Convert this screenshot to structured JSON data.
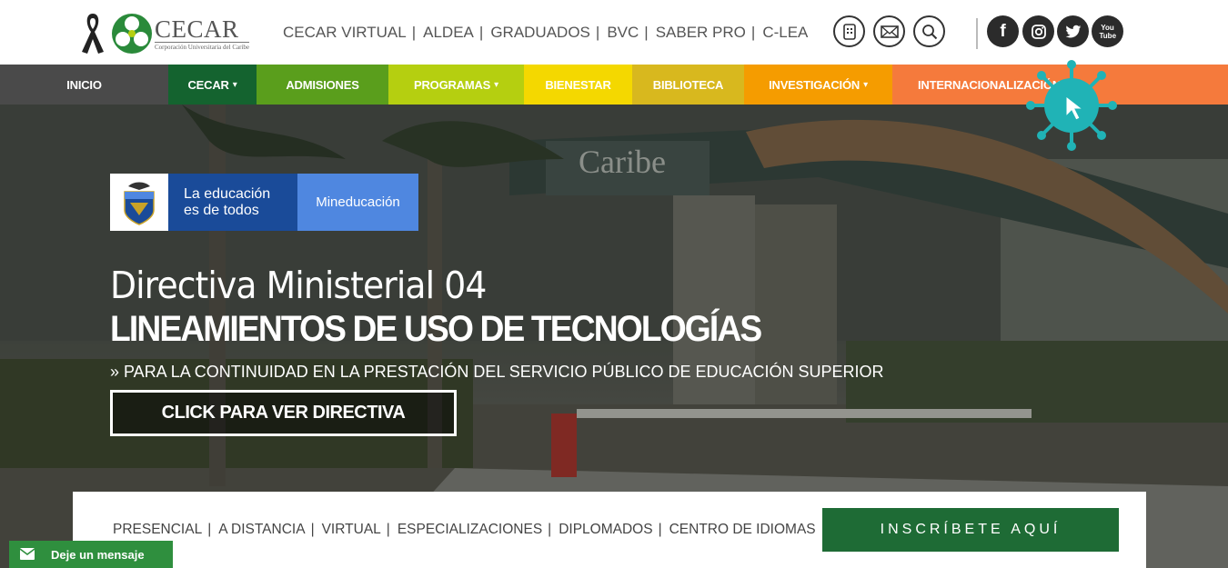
{
  "logo": {
    "name": "CECAR",
    "subtitle": "Corporación Universitaria del Caribe"
  },
  "top_links": [
    "CECAR VIRTUAL",
    "ALDEA",
    "GRADUADOS",
    "BVC",
    "SABER PRO",
    "C-LEA"
  ],
  "top_links_separator": "|",
  "header_icons": [
    "phone-icon",
    "mail-icon",
    "search-icon"
  ],
  "social_icons": [
    "facebook-icon",
    "instagram-icon",
    "twitter-icon",
    "youtube-icon"
  ],
  "social_labels": {
    "facebook": "f",
    "youtube": "You Tube"
  },
  "nav": [
    {
      "label": "INICIO",
      "color": "#4a4a4a",
      "dropdown": false
    },
    {
      "label": "CECAR",
      "color": "#14632f",
      "dropdown": true
    },
    {
      "label": "ADMISIONES",
      "color": "#5a9e1c",
      "dropdown": false
    },
    {
      "label": "PROGRAMAS",
      "color": "#b5cf10",
      "dropdown": true
    },
    {
      "label": "BIENESTAR",
      "color": "#f4d800",
      "dropdown": false
    },
    {
      "label": "BIBLIOTECA",
      "color": "#d8b81e",
      "dropdown": false
    },
    {
      "label": "INVESTIGACIÓN",
      "color": "#f59c00",
      "dropdown": true
    },
    {
      "label": "INTERNACIONALIZACIÓN",
      "color": "#f57a3c",
      "dropdown": false
    }
  ],
  "hero": {
    "gov_badge_line1": "La educación",
    "gov_badge_line2": "es de todos",
    "gov_badge_right": "Mineducación",
    "subtitle": "Directiva Ministerial 04",
    "title": "LINEAMIENTOS DE USO DE TECNOLOGÍAS",
    "description": "» PARA LA CONTINUIDAD EN LA PRESTACIÓN DEL SERVICIO PÚBLICO DE EDUCACIÓN SUPERIOR",
    "cta": "CLICK PARA VER DIRECTIVA",
    "background_sign": "Caribe"
  },
  "modalities": [
    "PRESENCIAL",
    "A DISTANCIA",
    "VIRTUAL",
    "ESPECIALIZACIONES",
    "DIPLOMADOS",
    "CENTRO DE IDIOMAS"
  ],
  "inscribe_label": "INSCRÍBETE AQUÍ",
  "chat_label": "Deje un mensaje",
  "colors": {
    "brand_green": "#1e6b35",
    "chat_green": "#2f8f3e",
    "virus_teal": "#20b3b6"
  }
}
